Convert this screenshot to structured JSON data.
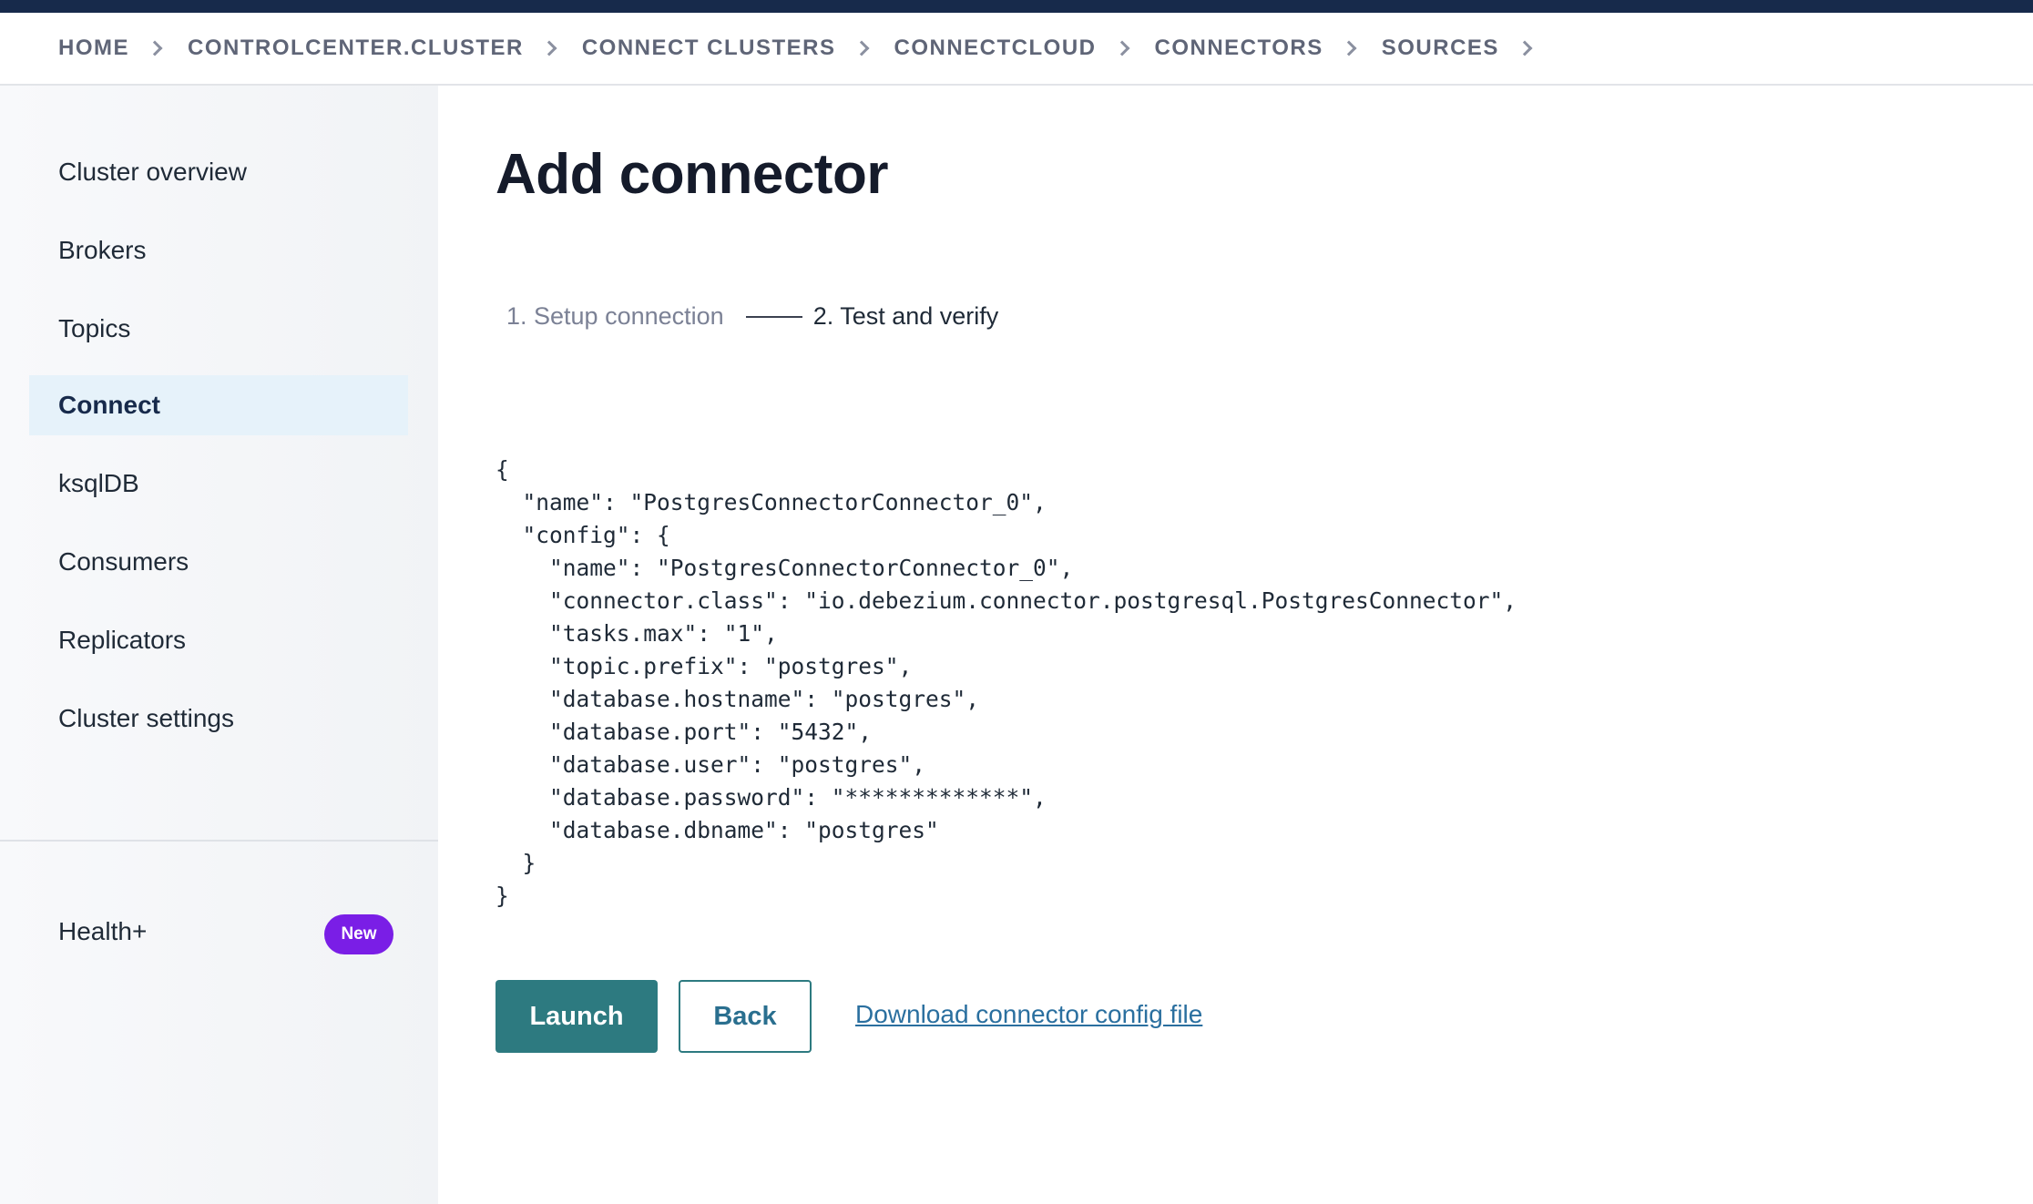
{
  "breadcrumb": {
    "items": [
      "HOME",
      "CONTROLCENTER.CLUSTER",
      "CONNECT CLUSTERS",
      "CONNECTCLOUD",
      "CONNECTORS",
      "SOURCES"
    ]
  },
  "sidebar": {
    "items": [
      {
        "label": "Cluster overview"
      },
      {
        "label": "Brokers"
      },
      {
        "label": "Topics"
      },
      {
        "label": "Connect",
        "active": true
      },
      {
        "label": "ksqlDB"
      },
      {
        "label": "Consumers"
      },
      {
        "label": "Replicators"
      },
      {
        "label": "Cluster settings"
      }
    ],
    "health": {
      "label": "Health+",
      "badge": "New"
    }
  },
  "main": {
    "title": "Add connector",
    "steps": [
      "1. Setup connection",
      "2. Test and verify"
    ],
    "config_text": "{\n  \"name\": \"PostgresConnectorConnector_0\",\n  \"config\": {\n    \"name\": \"PostgresConnectorConnector_0\",\n    \"connector.class\": \"io.debezium.connector.postgresql.PostgresConnector\",\n    \"tasks.max\": \"1\",\n    \"topic.prefix\": \"postgres\",\n    \"database.hostname\": \"postgres\",\n    \"database.port\": \"5432\",\n    \"database.user\": \"postgres\",\n    \"database.password\": \"*************\",\n    \"database.dbname\": \"postgres\"\n  }\n}",
    "launch_label": "Launch",
    "back_label": "Back",
    "download_label": "Download connector config file"
  },
  "colors": {
    "topbar": "#172a4b",
    "accent": "#2d7a80",
    "badge": "#7a1ee6",
    "active_nav_bg": "#e6f2fa"
  }
}
